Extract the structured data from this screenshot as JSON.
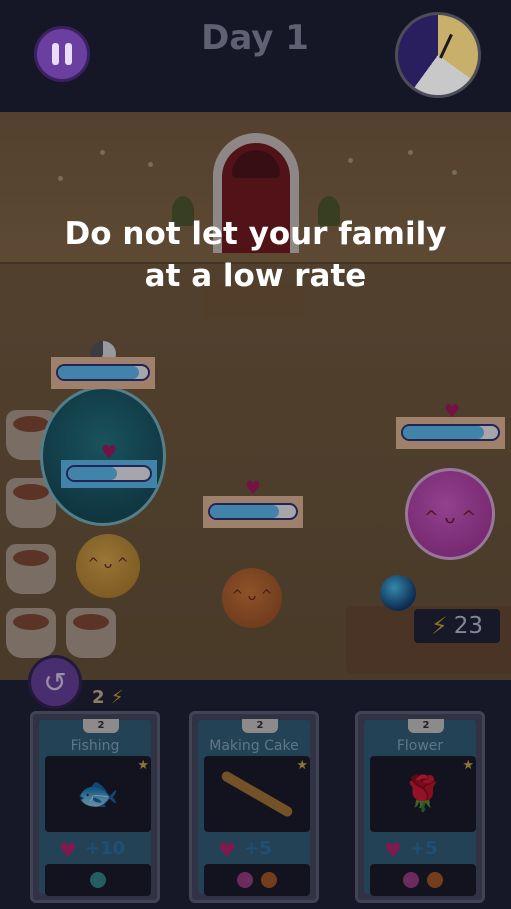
{
  "hud": {
    "day_label": "Day 1",
    "pause_icon": "pause-icon",
    "clock_icon": "day-clock-icon"
  },
  "tutorial": {
    "message_line1": "Do not let your family",
    "message_line2": "at a low rate"
  },
  "energy": {
    "current": "23",
    "bolt_icon": "lightning-icon"
  },
  "undo": {
    "icon": "undo-icon",
    "cost": "2"
  },
  "health_bars": [
    {
      "creature": "big-teal",
      "level": 0.9
    },
    {
      "creature": "big-teal-inner",
      "level": 0.6
    },
    {
      "creature": "orange",
      "level": 0.8
    },
    {
      "creature": "pink",
      "level": 0.85
    }
  ],
  "cards": [
    {
      "cost": "2",
      "title": "Fishing",
      "value": "+10",
      "art_icon": "fish-icon"
    },
    {
      "cost": "2",
      "title": "Making Cake",
      "value": "+5",
      "art_icon": "rolling-pin-icon"
    },
    {
      "cost": "2",
      "title": "Flower",
      "value": "+5",
      "art_icon": "rose-icon"
    }
  ],
  "colors": {
    "button_purple": "#6a3fa0",
    "health_fill": "#5fc8ff",
    "heart": "#c01f6b",
    "energy_bolt": "#d4a91e"
  }
}
